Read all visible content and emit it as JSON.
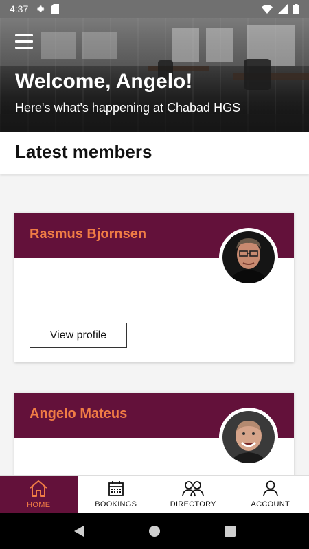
{
  "status_bar": {
    "time": "4:37",
    "icons": [
      "settings-icon",
      "sd-card-icon",
      "wifi-icon",
      "signal-icon",
      "battery-icon"
    ]
  },
  "hero": {
    "title": "Welcome, Angelo!",
    "subtitle": "Here's what's happening at Chabad HGS",
    "menu_icon": "hamburger-menu-icon"
  },
  "section": {
    "title": "Latest members"
  },
  "members": [
    {
      "name": "Rasmus Bjornsen",
      "button_label": "View profile",
      "avatar": "avatar-photo"
    },
    {
      "name": "Angelo Mateus",
      "avatar": "avatar-photo"
    }
  ],
  "bottom_nav": [
    {
      "label": "HOME",
      "icon": "home-icon",
      "active": true
    },
    {
      "label": "BOOKINGS",
      "icon": "calendar-icon",
      "active": false
    },
    {
      "label": "DIRECTORY",
      "icon": "people-icon",
      "active": false
    },
    {
      "label": "ACCOUNT",
      "icon": "user-icon",
      "active": false
    }
  ],
  "system_nav": [
    "back-icon",
    "home-circle-icon",
    "recents-icon"
  ],
  "colors": {
    "brand": "#63113a",
    "accent": "#f07c45",
    "status_bar": "#707070"
  }
}
